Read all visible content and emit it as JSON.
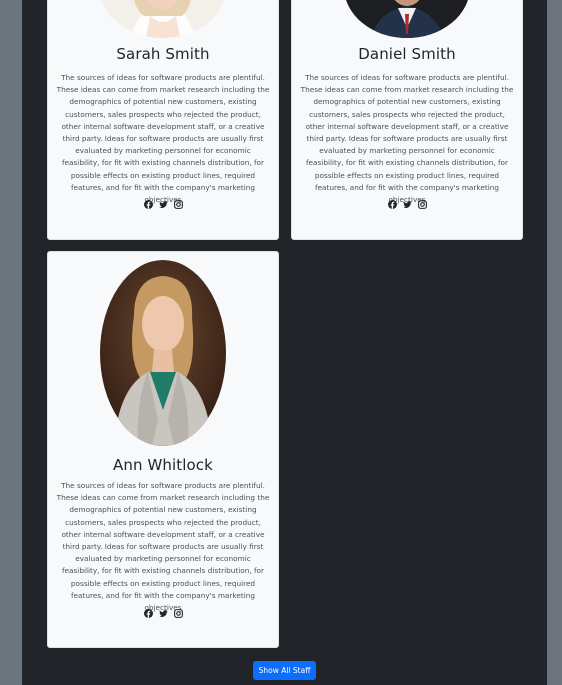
{
  "staff": [
    {
      "name": "Sarah Smith",
      "bio": "The sources of ideas for software products are plentiful. These ideas can come from market research including the demographics of potential new customers, existing customers, sales prospects who rejected the product, other internal software development staff, or a creative third party. Ideas for software products are usually first evaluated by marketing personnel for economic feasibility, for fit with existing channels distribution, for possible effects on existing product lines, required features, and for fit with the company's marketing objectives",
      "socials": [
        "facebook-icon",
        "twitter-icon",
        "instagram-icon"
      ]
    },
    {
      "name": "Daniel Smith",
      "bio": "The sources of ideas for software products are plentiful. These ideas can come from market research including the demographics of potential new customers, existing customers, sales prospects who rejected the product, other internal software development staff, or a creative third party. Ideas for software products are usually first evaluated by marketing personnel for economic feasibility, for fit with existing channels distribution, for possible effects on existing product lines, required features, and for fit with the company's marketing objectives",
      "socials": [
        "facebook-icon",
        "twitter-icon",
        "instagram-icon"
      ]
    },
    {
      "name": "Ann Whitlock",
      "bio": "The sources of ideas for software products are plentiful. These ideas can come from market research including the demographics of potential new customers, existing customers, sales prospects who rejected the product, other internal software development staff, or a creative third party. Ideas for software products are usually first evaluated by marketing personnel for economic feasibility, for fit with existing channels distribution, for possible effects on existing product lines, required features, and for fit with the company's marketing objectives",
      "socials": [
        "facebook-icon",
        "twitter-icon",
        "instagram-icon"
      ]
    }
  ],
  "show_all_label": "Show All Staff",
  "colors": {
    "page_bg": "#6c757d",
    "panel_bg": "#212529",
    "card_bg": "#f8f9fa",
    "button_bg": "#0d6efd"
  }
}
